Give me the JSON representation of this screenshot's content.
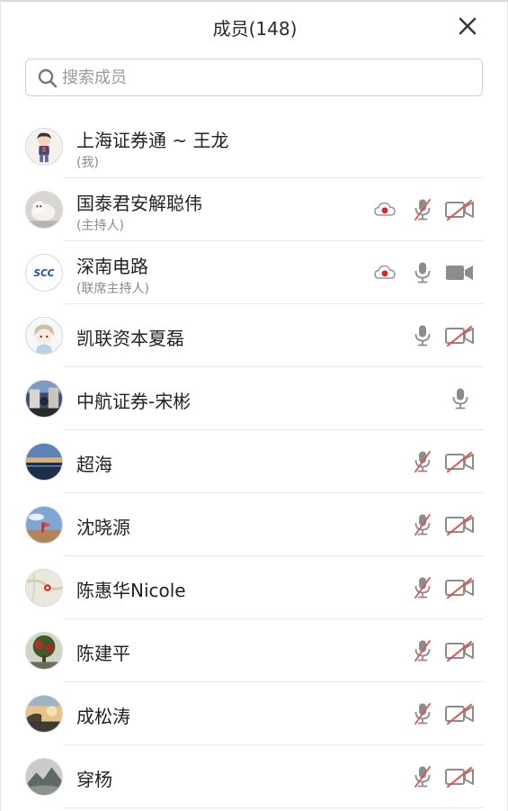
{
  "header": {
    "title": "成员(148)"
  },
  "search": {
    "placeholder": "搜索成员"
  },
  "colors": {
    "icon_gray": "#8c8c8c",
    "muted_red": "#e0524f",
    "record_red": "#e0241b"
  },
  "members": [
    {
      "name": "上海证券通 ~ 王龙",
      "role": "(我)",
      "mic": "none",
      "cam": "none",
      "recording": false,
      "avatar": "cartoon-boy"
    },
    {
      "name": "国泰君安解聪伟",
      "role": "(主持人)",
      "mic": "muted",
      "cam": "off",
      "recording": true,
      "avatar": "cat-photo"
    },
    {
      "name": "深南电路",
      "role": "(联席主持人)",
      "mic": "on",
      "cam": "on",
      "recording": true,
      "avatar": "scc-logo",
      "avatar_text": "SCC"
    },
    {
      "name": "凯联资本夏磊",
      "role": "",
      "mic": "on",
      "cam": "off",
      "recording": false,
      "avatar": "anime-girl"
    },
    {
      "name": "中航证券-宋彬",
      "role": "",
      "mic": "on",
      "cam": "none",
      "recording": false,
      "avatar": "street-photo"
    },
    {
      "name": "超海",
      "role": "",
      "mic": "muted",
      "cam": "off",
      "recording": false,
      "avatar": "sunset-sea"
    },
    {
      "name": "沈晓源",
      "role": "",
      "mic": "muted",
      "cam": "off",
      "recording": false,
      "avatar": "beach-sky"
    },
    {
      "name": "陈惠华Nicole",
      "role": "",
      "mic": "muted",
      "cam": "off",
      "recording": false,
      "avatar": "map"
    },
    {
      "name": "陈建平",
      "role": "",
      "mic": "muted",
      "cam": "off",
      "recording": false,
      "avatar": "red-tree"
    },
    {
      "name": "成松涛",
      "role": "",
      "mic": "muted",
      "cam": "off",
      "recording": false,
      "avatar": "sunset-coast"
    },
    {
      "name": "穿杨",
      "role": "",
      "mic": "muted",
      "cam": "off",
      "recording": false,
      "avatar": "mountain"
    }
  ]
}
